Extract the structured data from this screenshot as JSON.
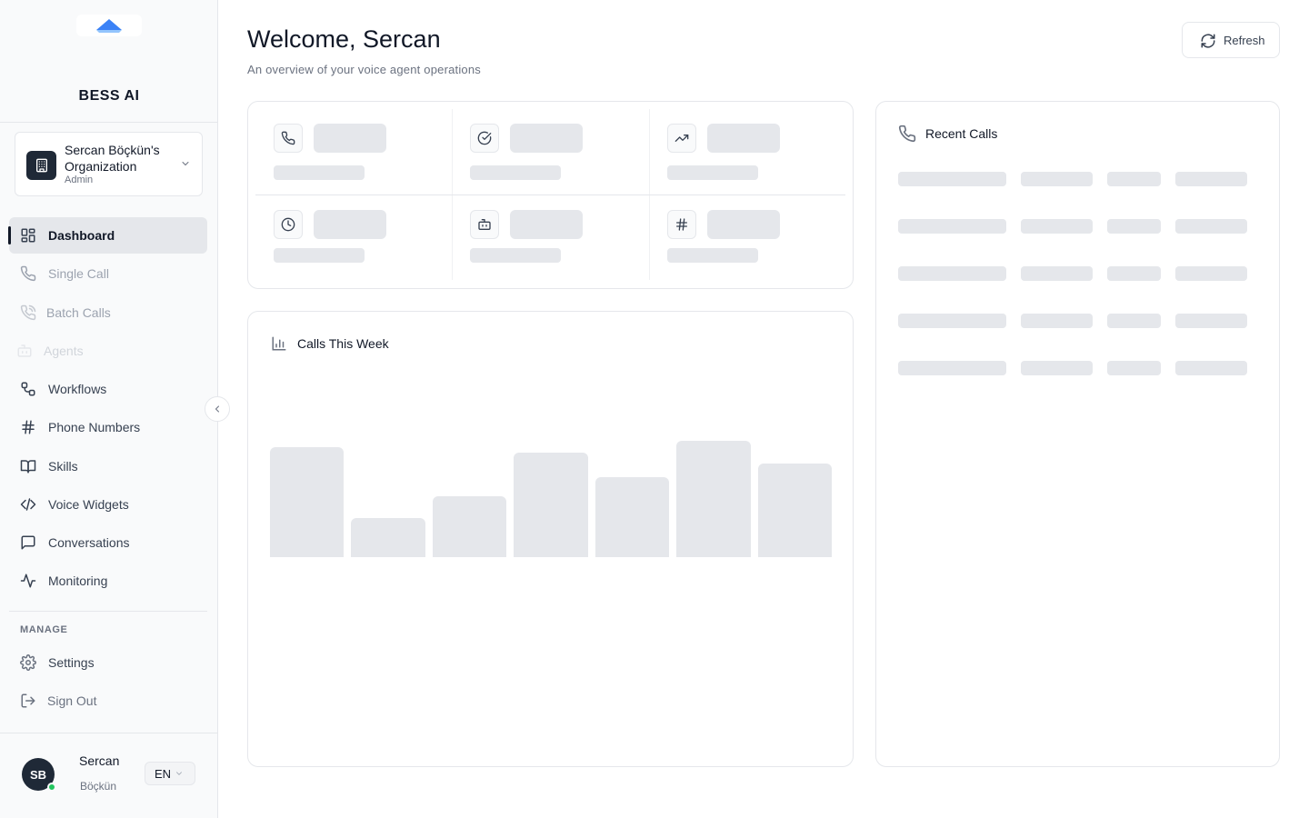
{
  "brand": {
    "name": "BESS AI"
  },
  "organization": {
    "name": "Sercan Böçkün's Organization",
    "role": "Admin"
  },
  "nav": {
    "items": [
      {
        "label": "Dashboard",
        "icon": "dashboard-icon",
        "state": "active"
      },
      {
        "label": "Single Call",
        "icon": "phone-icon",
        "state": "dim"
      },
      {
        "label": "Batch Calls",
        "icon": "phone-call-icon",
        "state": "dim"
      },
      {
        "label": "Agents",
        "icon": "bot-icon",
        "state": "faint"
      },
      {
        "label": "Workflows",
        "icon": "workflow-icon",
        "state": "normal"
      },
      {
        "label": "Phone Numbers",
        "icon": "hash-icon",
        "state": "normal"
      },
      {
        "label": "Skills",
        "icon": "book-icon",
        "state": "normal"
      },
      {
        "label": "Voice Widgets",
        "icon": "code-icon",
        "state": "normal"
      },
      {
        "label": "Conversations",
        "icon": "message-icon",
        "state": "normal"
      },
      {
        "label": "Monitoring",
        "icon": "activity-icon",
        "state": "normal"
      }
    ],
    "manage_heading": "MANAGE",
    "manage_items": [
      {
        "label": "Settings",
        "icon": "gear-icon"
      },
      {
        "label": "Sign Out",
        "icon": "sign-out-icon"
      }
    ]
  },
  "user": {
    "initials": "SB",
    "first_name": "Sercan",
    "last_name": "Böçkün",
    "status": "online"
  },
  "language": {
    "selected": "EN"
  },
  "header": {
    "title": "Welcome, Sercan",
    "subtitle": "An overview of your voice agent operations",
    "refresh_label": "Refresh"
  },
  "stats": {
    "icons": [
      "phone-icon",
      "check-circle-icon",
      "trending-up-icon",
      "clock-icon",
      "bot-icon",
      "hash-icon"
    ],
    "state": "loading"
  },
  "calls_chart": {
    "title": "Calls This Week",
    "state": "loading",
    "placeholder_bar_levels": [
      0.67,
      0.24,
      0.37,
      0.64,
      0.49,
      0.71,
      0.57
    ]
  },
  "recent_calls": {
    "title": "Recent Calls",
    "state": "loading",
    "placeholder_rows": 5
  },
  "colors": {
    "sidebar_bg": "#f9fafb",
    "active_nav_bg": "#e5e7eb",
    "skeleton": "#e5e7eb",
    "avatar_bg": "#1f2937",
    "online": "#22c55e",
    "logo_blue": "#3b82f6"
  }
}
